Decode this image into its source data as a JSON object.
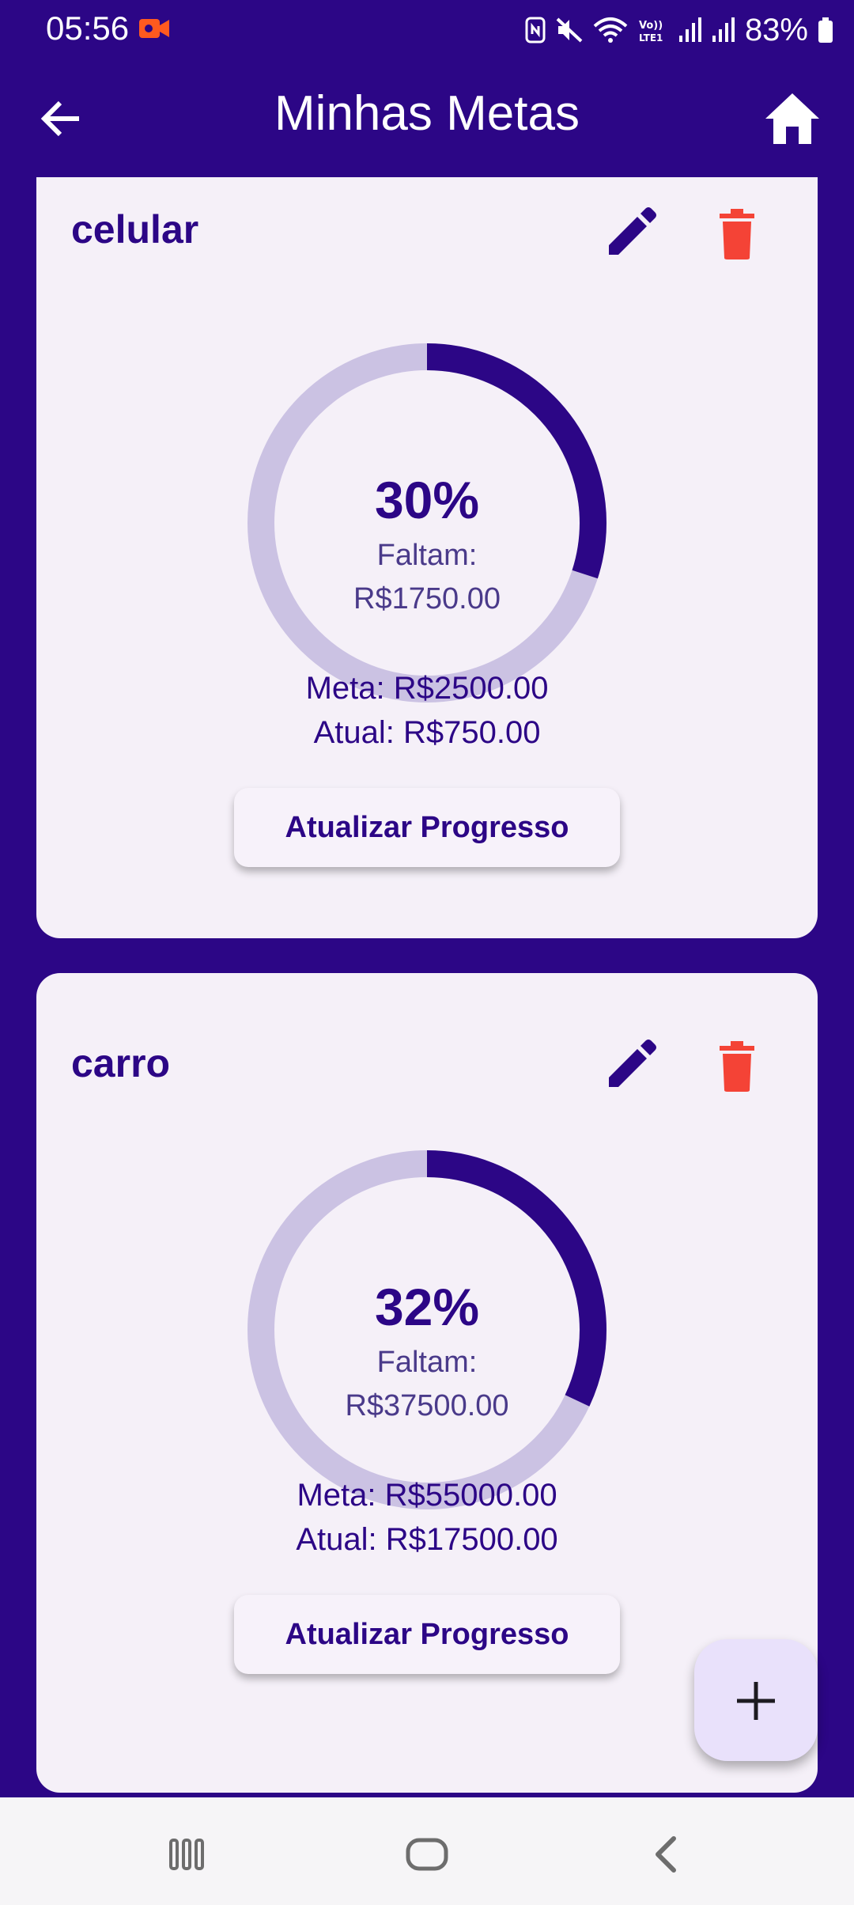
{
  "status_bar": {
    "time": "05:56",
    "battery": "83%",
    "icons": [
      "video-record-icon",
      "nfc-icon",
      "mute-icon",
      "wifi-icon",
      "volte-icon",
      "signal-icon",
      "signal-icon",
      "battery-icon"
    ]
  },
  "app_bar": {
    "title": "Minhas Metas",
    "back_icon": "arrow-back-icon",
    "home_icon": "home-icon"
  },
  "colors": {
    "primary": "#2c0686",
    "card_bg": "#f5f0f8",
    "ring_track": "#cbc2e3",
    "delete": "#f44336",
    "fab_bg": "#e9e1fb"
  },
  "goals": [
    {
      "name": "celular",
      "percent_label": "30%",
      "progress": 0.3,
      "remaining_label": "Faltam:",
      "remaining_value": "R$1750.00",
      "meta": "Meta: R$2500.00",
      "atual": "Atual: R$750.00",
      "button_label": "Atualizar Progresso"
    },
    {
      "name": "carro",
      "percent_label": "32%",
      "progress": 0.32,
      "remaining_label": "Faltam:",
      "remaining_value": "R$37500.00",
      "meta": "Meta: R$55000.00",
      "atual": "Atual: R$17500.00",
      "button_label": "Atualizar Progresso"
    }
  ],
  "fab": {
    "icon": "add-icon"
  },
  "nav_bar": {
    "icons": [
      "recent-apps-icon",
      "home-nav-icon",
      "back-nav-icon"
    ]
  }
}
